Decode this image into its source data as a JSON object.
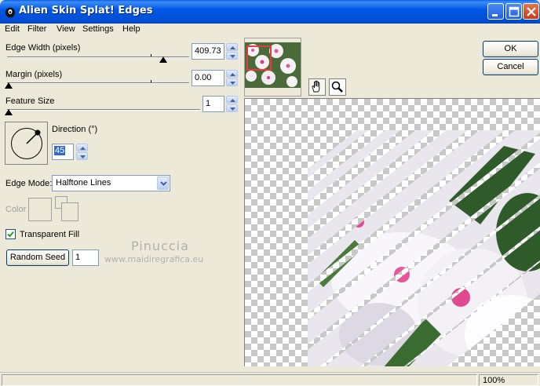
{
  "window": {
    "title": "Alien Skin Splat! Edges"
  },
  "menu": {
    "items": [
      "Edit",
      "Filter",
      "View",
      "Settings",
      "Help"
    ]
  },
  "params": {
    "edge_width": {
      "label": "Edge Width (pixels)",
      "value": "409.73"
    },
    "margin": {
      "label": "Margin (pixels)",
      "value": "0.00"
    },
    "feature_size": {
      "label": "Feature Size",
      "value": "1"
    },
    "direction": {
      "label": "Direction (°)",
      "value": "45"
    },
    "edge_mode": {
      "label": "Edge Mode:",
      "value": "Halftone Lines"
    },
    "color": {
      "label": "Color"
    },
    "transparent_fill": {
      "label": "Transparent Fill",
      "checked": true
    },
    "random_seed": {
      "button": "Random Seed",
      "value": "1"
    }
  },
  "buttons": {
    "ok": "OK",
    "cancel": "Cancel"
  },
  "watermark": {
    "name": "Pinuccia",
    "url": "www.maidiregrafica.eu"
  },
  "status": {
    "zoom": "100%"
  },
  "colors": {
    "titlebar": "#0058e6",
    "flower_pink": "#e8559a",
    "leaf_green": "#2f5a2a"
  }
}
